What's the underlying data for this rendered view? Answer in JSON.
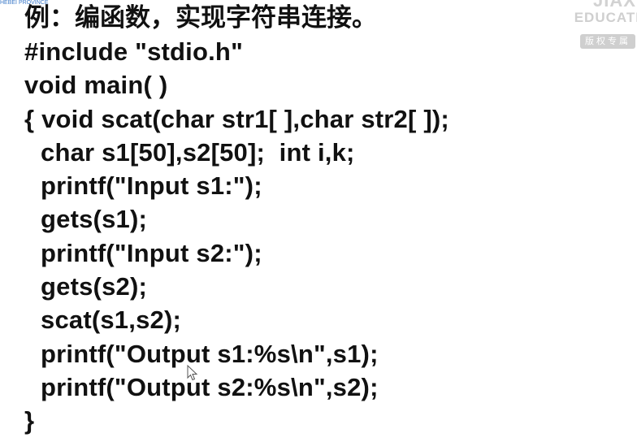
{
  "header": {
    "corner_caption": "HEBEI PROVINCE",
    "title": "例：编函数，实现字符串连接。"
  },
  "watermark": {
    "line1": "JIAXI",
    "line2": "EDUCATI",
    "badge": "版权专属"
  },
  "code": {
    "lines": [
      "#include \"stdio.h\"",
      "void main( )",
      "{ void scat(char str1[ ],char str2[ ]);",
      "char s1[50],s2[50];  int i,k;",
      "printf(\"Input s1:\");",
      "gets(s1);",
      "printf(\"Input s2:\");",
      "gets(s2);",
      "scat(s1,s2);",
      "printf(\"Output s1:%s\\n\",s1);",
      "printf(\"Output s2:%s\\n\",s2);",
      "}"
    ]
  },
  "colors": {
    "text": "#111111",
    "caption": "#3a78c8",
    "watermark": "#cfcfcf"
  },
  "icons": {
    "cursor": "mouse-pointer-icon"
  }
}
